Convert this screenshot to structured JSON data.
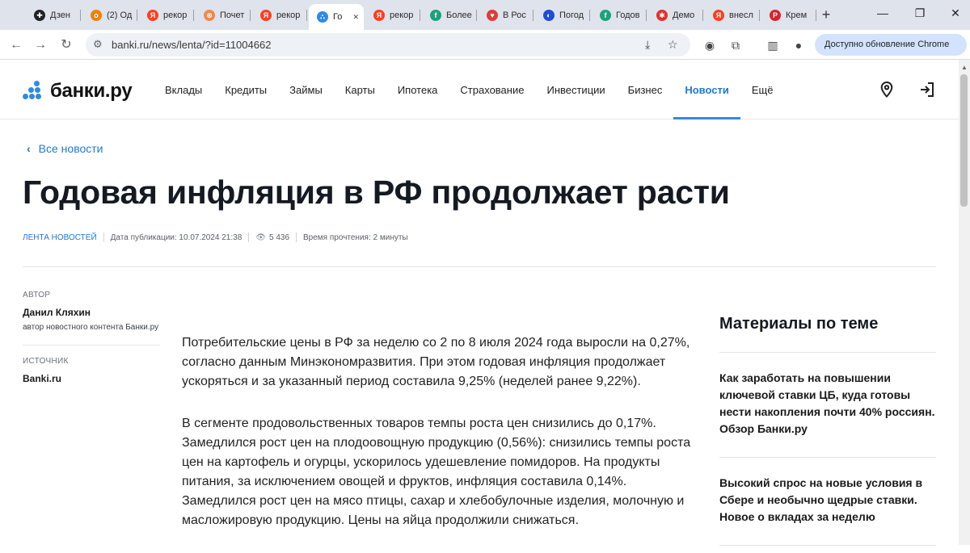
{
  "browser": {
    "tabs": [
      {
        "label": "Дзен",
        "fav_color": "#202124",
        "fav_glyph": "✚"
      },
      {
        "label": "(2) Од",
        "fav_color": "#ee8208",
        "fav_glyph": "о"
      },
      {
        "label": "рекор",
        "fav_color": "#fc3f1d",
        "fav_glyph": "Я"
      },
      {
        "label": "Почет",
        "fav_color": "#f08a4b",
        "fav_glyph": "⊗"
      },
      {
        "label": "рекор",
        "fav_color": "#fc3f1d",
        "fav_glyph": "Я"
      },
      {
        "label": "Го",
        "fav_color": "#2f8ae6",
        "fav_glyph": "∴",
        "active": true
      },
      {
        "label": "рекор",
        "fav_color": "#fc3f1d",
        "fav_glyph": "Я"
      },
      {
        "label": "Более",
        "fav_color": "#1aa37a",
        "fav_glyph": "f"
      },
      {
        "label": "В Рос",
        "fav_color": "#e23b3b",
        "fav_glyph": "♥"
      },
      {
        "label": "Погод",
        "fav_color": "#1d4ed8",
        "fav_glyph": "◐"
      },
      {
        "label": "Годов",
        "fav_color": "#1aa37a",
        "fav_glyph": "f"
      },
      {
        "label": "Демо",
        "fav_color": "#e0322c",
        "fav_glyph": "✱"
      },
      {
        "label": "внесл",
        "fav_color": "#fc3f1d",
        "fav_glyph": "Я"
      },
      {
        "label": "Крем",
        "fav_color": "#d8232a",
        "fav_glyph": "Р"
      }
    ],
    "url": "banki.ru/news/lenta/?id=11004662",
    "update_label": "Доступно обновление Chrome"
  },
  "site": {
    "logo": "банки.ру",
    "nav": [
      "Вклады",
      "Кредиты",
      "Займы",
      "Карты",
      "Ипотека",
      "Страхование",
      "Инвестиции",
      "Бизнес",
      "Новости",
      "Ещё"
    ],
    "nav_active": "Новости",
    "accent": "#2f8ae6"
  },
  "article": {
    "back_label": "Все новости",
    "title": "Годовая инфляция в РФ продолжает расти",
    "section": "ЛЕНТА НОВОСТЕЙ",
    "published": "Дата публикации: 10.07.2024 21:38",
    "views": "5 436",
    "read_time": "Время прочтения: 2 минуты",
    "author_label": "АВТОР",
    "author_name": "Данил Кляхин",
    "author_role": "автор новостного контента Банки.ру",
    "source_label": "ИСТОЧНИК",
    "source_name": "Banki.ru",
    "paragraphs": [
      "Потребительские цены в РФ за неделю со 2 по 8 июля 2024 года выросли на 0,27%, согласно данным Минэкономразвития. При этом годовая инфляция продолжает ускоряться и за указанный период составила 9,25% (неделей ранее 9,22%).",
      "В сегменте продовольственных товаров темпы роста цен снизились до 0,17%. Замедлился рост цен на плодоовощную продукцию (0,56%): снизились темпы роста цен на картофель и огурцы, ускорилось удешевление помидоров. На продукты питания, за исключением овощей и фруктов, инфляция составила 0,14%. Замедлился рост цен на мясо птицы, сахар и хлебобулочные изделия, молочную и масложировую продукцию. Цены на яйца продолжили снижаться."
    ]
  },
  "related": {
    "title": "Материалы по теме",
    "items": [
      "Как заработать на повышении ключевой ставки ЦБ, куда готовы нести накопления почти 40% россиян. Обзор Банки.ру",
      "Высокий спрос на новые условия в Сбере и необычно щедрые ставки. Новое о вкладах за неделю"
    ]
  }
}
